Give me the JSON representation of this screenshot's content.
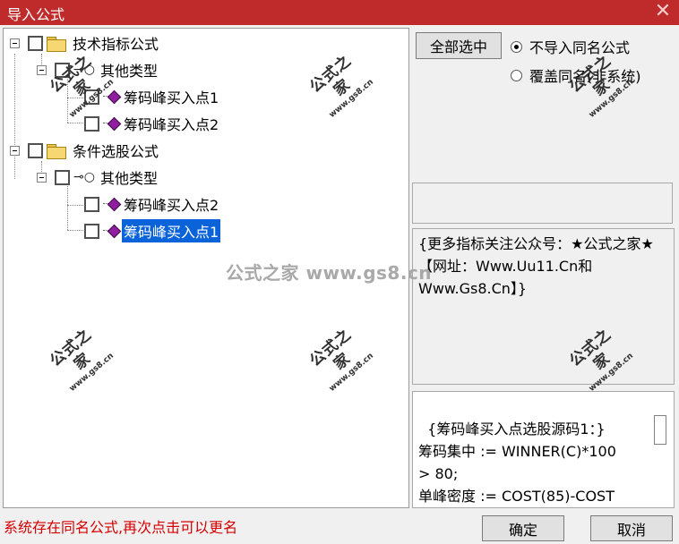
{
  "window": {
    "title": "导入公式",
    "close_glyph": "✕"
  },
  "tree": {
    "groups": [
      {
        "label": "技术指标公式",
        "category": "其他类型",
        "items": [
          "筹码峰买入点1",
          "筹码峰买入点2"
        ]
      },
      {
        "label": "条件选股公式",
        "category": "其他类型",
        "items": [
          "筹码峰买入点2",
          "筹码峰买入点1"
        ]
      }
    ],
    "selected_item": "筹码峰买入点1"
  },
  "options": {
    "select_all_label": "全部选中",
    "no_import_same_name_label": "不导入同名公式",
    "overwrite_same_name_label": "覆盖同名(非系统)",
    "selected_option": "不导入同名公式"
  },
  "description_text": "{更多指标关注公众号：★公式之家★【网址：Www.Uu11.Cn和Www.Gs8.Cn】}",
  "source_code_text": "{筹码峰买入点选股源码1：}\n筹码集中 := WINNER(C)*100\n> 80;\n单峰密度 := COST(85)-COST",
  "status_message": "系统存在同名公式,再次点击可以更名",
  "buttons": {
    "ok_label": "确定",
    "cancel_label": "取消"
  },
  "watermarks": {
    "center_text": "公式之家 www.gs8.cn",
    "stamp_title": "公式之家",
    "stamp_url": "www.gs8.cn"
  },
  "icons": {
    "folder": "folder-icon",
    "key": "key-icon",
    "formula": "formula-gem-icon",
    "expander": "tree-expander-minus-icon",
    "close": "close-icon"
  },
  "colors": {
    "titlebar": "#bf2b2b",
    "selection": "#0a63d8",
    "status_text": "#d40000",
    "formula_gem": "#8f1f9e"
  }
}
